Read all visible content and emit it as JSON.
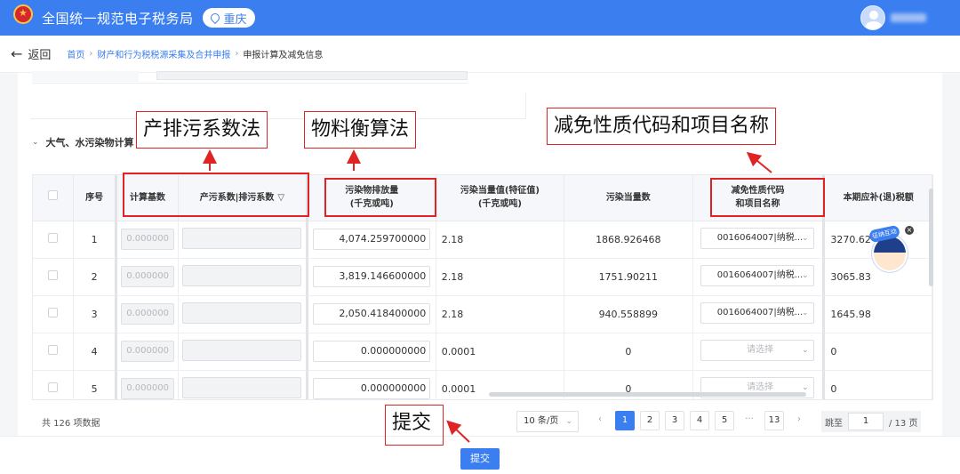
{
  "header": {
    "app_title": "全国统一规范电子税务局",
    "region": "重庆"
  },
  "nav": {
    "back_label": "返回",
    "breadcrumbs": [
      "首页",
      "财产和行为税税源采集及合并申报",
      "申报计算及减免信息"
    ]
  },
  "section": {
    "title": "大气、水污染物计算"
  },
  "table": {
    "columns": {
      "select": "",
      "index": "序号",
      "base": "计算基数",
      "coef": "产污系数|排污系数",
      "emission_1": "污染物排放量",
      "emission_2": "(千克或吨)",
      "equiv_1": "污染当量值(特征值)",
      "equiv_2": "(千克或吨)",
      "equiv_count": "污染当量数",
      "relief_1": "减免性质代码",
      "relief_2": "和项目名称",
      "tax": "本期应补(退)税额"
    },
    "rows": [
      {
        "index": "1",
        "base": "0.000000",
        "emission": "4,074.259700000",
        "equiv": "2.18",
        "count": "1868.926468",
        "relief": "0016064007|纳税...",
        "tax": "3270.62"
      },
      {
        "index": "2",
        "base": "0.000000",
        "emission": "3,819.146600000",
        "equiv": "2.18",
        "count": "1751.90211",
        "relief": "0016064007|纳税...",
        "tax": "3065.83"
      },
      {
        "index": "3",
        "base": "0.000000",
        "emission": "2,050.418400000",
        "equiv": "2.18",
        "count": "940.558899",
        "relief": "0016064007|纳税...",
        "tax": "1645.98"
      },
      {
        "index": "4",
        "base": "0.000000",
        "emission": "0.000000000",
        "equiv": "0.0001",
        "count": "0",
        "relief": "请选择",
        "tax": "0"
      },
      {
        "index": "5",
        "base": "0.000000",
        "emission": "0.000000000",
        "equiv": "0.0001",
        "count": "0",
        "relief": "请选择",
        "tax": "0"
      }
    ]
  },
  "pagination": {
    "total": "共 126 项数据",
    "page_size": "10 条/页",
    "pages": [
      "1",
      "2",
      "3",
      "4",
      "5",
      "···",
      "13"
    ],
    "prev": "‹",
    "next": "›",
    "jump_label": "跳至",
    "jump_value": "1",
    "jump_total": "/ 13 页"
  },
  "footer": {
    "submit_label": "提交"
  },
  "annotations": {
    "method_1": "产排污系数法",
    "method_2": "物料衡算法",
    "relief": "减免性质代码和项目名称",
    "submit": "提交"
  },
  "mascot": {
    "badge": "征纳互动",
    "close": "×"
  },
  "colors": {
    "primary": "#3a7ef0",
    "annotation": "#e02424"
  }
}
